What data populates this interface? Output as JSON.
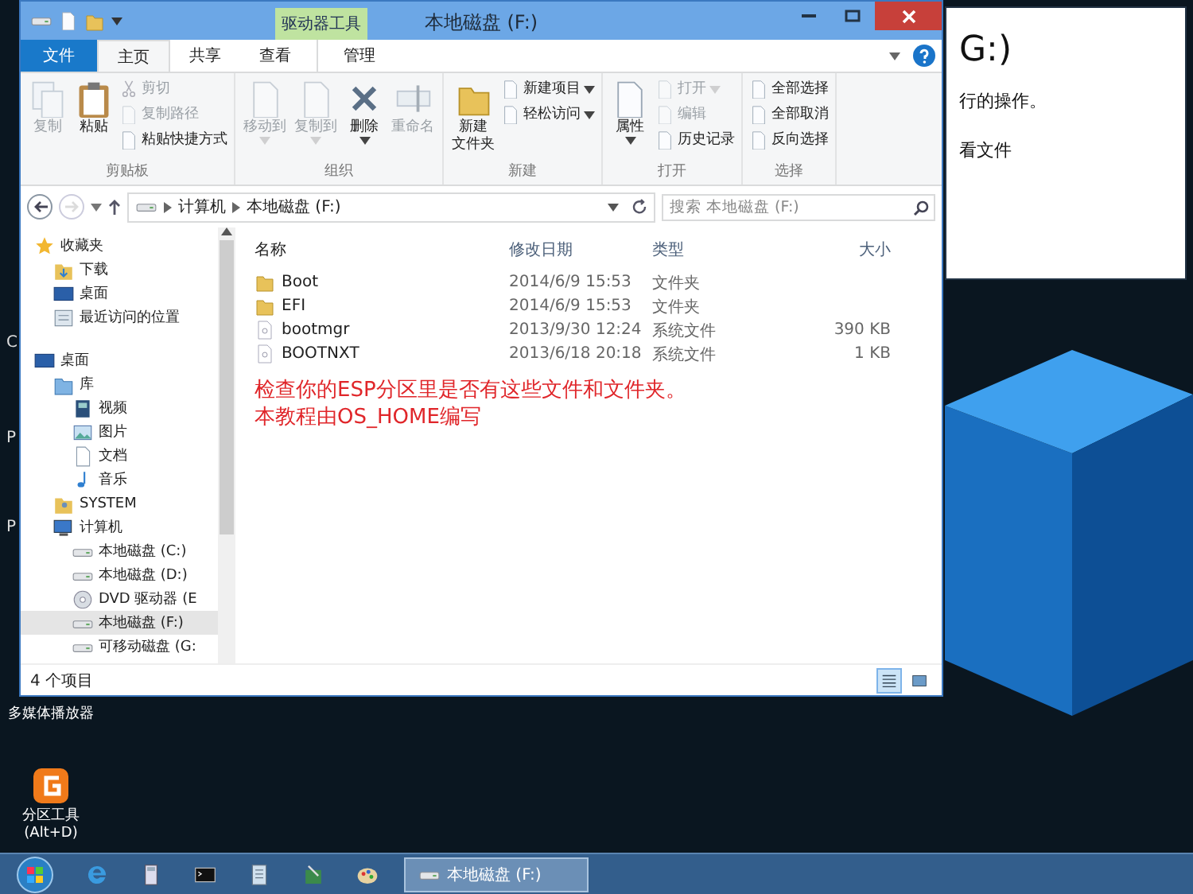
{
  "window": {
    "title": "本地磁盘 (F:)",
    "context_tab": "驱动器工具"
  },
  "tabs": [
    {
      "label": "文件",
      "kind": "file",
      "selected": false
    },
    {
      "label": "主页",
      "kind": "normal",
      "selected": true
    },
    {
      "label": "共享",
      "kind": "normal",
      "selected": false
    },
    {
      "label": "查看",
      "kind": "normal",
      "selected": false
    },
    {
      "label": "管理",
      "kind": "context",
      "selected": false
    }
  ],
  "ribbon": [
    {
      "label": "剪贴板",
      "large": [
        {
          "lines": [
            "复制"
          ],
          "kind": "copy",
          "disabled": true,
          "dropdown": false
        },
        {
          "lines": [
            "粘贴"
          ],
          "kind": "paste",
          "disabled": false,
          "dropdown": false
        }
      ],
      "small": [
        {
          "label": "剪切",
          "kind": "cut",
          "disabled": true,
          "dropdown": false
        },
        {
          "label": "复制路径",
          "kind": "page",
          "disabled": true,
          "dropdown": false
        },
        {
          "label": "粘贴快捷方式",
          "kind": "page",
          "disabled": false,
          "dropdown": false
        }
      ]
    },
    {
      "label": "组织",
      "large": [
        {
          "lines": [
            "移动到"
          ],
          "kind": "page",
          "disabled": true,
          "dropdown": true
        },
        {
          "lines": [
            "复制到"
          ],
          "kind": "page",
          "disabled": true,
          "dropdown": true
        },
        {
          "lines": [
            "删除"
          ],
          "kind": "delete",
          "disabled": false,
          "dropdown": true
        },
        {
          "lines": [
            "重命名"
          ],
          "kind": "rename",
          "disabled": true,
          "dropdown": false
        }
      ]
    },
    {
      "label": "新建",
      "large": [
        {
          "lines": [
            "新建",
            "文件夹"
          ],
          "kind": "folder",
          "disabled": false,
          "dropdown": false
        }
      ],
      "small": [
        {
          "label": "新建项目",
          "kind": "page",
          "disabled": false,
          "dropdown": true
        },
        {
          "label": "轻松访问",
          "kind": "page",
          "disabled": false,
          "dropdown": true
        }
      ]
    },
    {
      "label": "打开",
      "large": [
        {
          "lines": [
            "属性"
          ],
          "kind": "page",
          "disabled": false,
          "dropdown": true
        }
      ],
      "small": [
        {
          "label": "打开",
          "kind": "page",
          "disabled": true,
          "dropdown": true
        },
        {
          "label": "编辑",
          "kind": "page",
          "disabled": true,
          "dropdown": false
        },
        {
          "label": "历史记录",
          "kind": "page",
          "disabled": false,
          "dropdown": false
        }
      ]
    },
    {
      "label": "选择",
      "small": [
        {
          "label": "全部选择",
          "kind": "page",
          "disabled": false,
          "dropdown": false
        },
        {
          "label": "全部取消",
          "kind": "page",
          "disabled": false,
          "dropdown": false
        },
        {
          "label": "反向选择",
          "kind": "page",
          "disabled": false,
          "dropdown": false
        }
      ]
    }
  ],
  "navigation": {
    "back_disabled": false,
    "forward_disabled": true,
    "breadcrumb": [
      "计算机",
      "本地磁盘 (F:)"
    ],
    "search": {
      "placeholder": "搜索 本地磁盘 (F:)"
    }
  },
  "sidebar": {
    "items": [
      {
        "label": "收藏夹",
        "kind": "star",
        "selected": false,
        "children": [
          {
            "label": "下载",
            "kind": "download",
            "selected": false
          },
          {
            "label": "桌面",
            "kind": "desktop",
            "selected": false
          },
          {
            "label": "最近访问的位置",
            "kind": "recent",
            "selected": false
          }
        ]
      },
      {
        "label": "桌面",
        "kind": "desktop",
        "selected": false,
        "children": [
          {
            "label": "库",
            "kind": "library",
            "selected": false,
            "children": [
              {
                "label": "视频",
                "kind": "video",
                "selected": false
              },
              {
                "label": "图片",
                "kind": "picture",
                "selected": false
              },
              {
                "label": "文档",
                "kind": "document",
                "selected": false
              },
              {
                "label": "音乐",
                "kind": "music",
                "selected": false
              }
            ]
          },
          {
            "label": "SYSTEM",
            "kind": "user",
            "selected": false
          },
          {
            "label": "计算机",
            "kind": "computer",
            "selected": false,
            "children": [
              {
                "label": "本地磁盘 (C:)",
                "kind": "drive",
                "selected": false
              },
              {
                "label": "本地磁盘 (D:)",
                "kind": "drive",
                "selected": false
              },
              {
                "label": "DVD 驱动器 (E",
                "kind": "dvd",
                "selected": false
              },
              {
                "label": "本地磁盘 (F:)",
                "kind": "drive",
                "selected": true
              },
              {
                "label": "可移动磁盘 (G:",
                "kind": "drive",
                "selected": false
              }
            ]
          }
        ]
      }
    ]
  },
  "table": {
    "columns": [
      "名称",
      "修改日期",
      "类型",
      "大小"
    ],
    "rows": [
      {
        "name": "Boot",
        "modified": "2014/6/9 15:53",
        "type": "文件夹",
        "size": "",
        "kind": "folder"
      },
      {
        "name": "EFI",
        "modified": "2014/6/9 15:53",
        "type": "文件夹",
        "size": "",
        "kind": "folder"
      },
      {
        "name": "bootmgr",
        "modified": "2013/9/30 12:24",
        "type": "系统文件",
        "size": "390 KB",
        "kind": "file"
      },
      {
        "name": "BOOTNXT",
        "modified": "2013/6/18 20:18",
        "type": "系统文件",
        "size": "1 KB",
        "kind": "file"
      }
    ]
  },
  "annotation": [
    "检查你的ESP分区里是否有这些文件和文件夹。",
    "本教程由OS_HOME编写"
  ],
  "status_bar": {
    "text": "4 个项目",
    "view_buttons": [
      {
        "kind": "details",
        "selected": true
      },
      {
        "kind": "icons",
        "selected": false
      }
    ]
  },
  "background_window": {
    "title": "G:)",
    "lines": [
      "行的操作。",
      "看文件"
    ]
  },
  "desktop": {
    "fragments": [
      "C",
      "P",
      "P"
    ],
    "icons": [
      {
        "label": "多媒体播放器"
      },
      {
        "label": "分区工具\n(Alt+D)",
        "kind": "partition"
      }
    ]
  },
  "taskbar": {
    "tasks": [
      {
        "label": "本地磁盘 (F:)",
        "selected": true
      }
    ]
  }
}
